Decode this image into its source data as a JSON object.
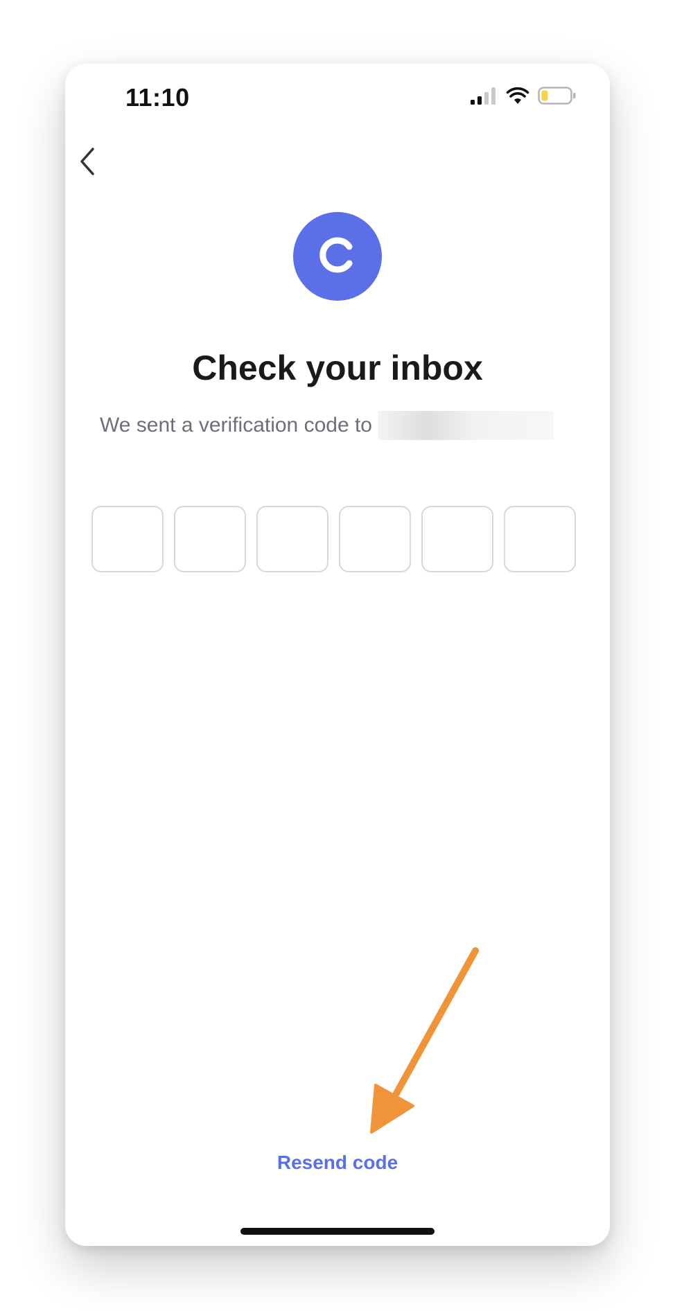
{
  "status_bar": {
    "time": "11:10",
    "icons": [
      "cellular-signal-icon",
      "wifi-icon",
      "battery-low-icon"
    ]
  },
  "navigation": {
    "back_icon": "chevron-left-icon"
  },
  "logo": {
    "letter": "C",
    "color": "#5b6fe6"
  },
  "heading": "Check your inbox",
  "subtitle": {
    "text": "We sent a verification code to"
  },
  "code_inputs": {
    "count": 6,
    "values": [
      "",
      "",
      "",
      "",
      "",
      ""
    ]
  },
  "resend_label": "Resend code",
  "colors": {
    "accent": "#5b6fe6",
    "arrow": "#f0943a",
    "battery_fill": "#f5d547"
  }
}
